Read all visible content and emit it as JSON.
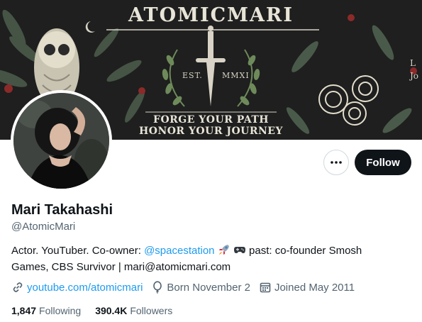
{
  "banner": {
    "title": "ATOMICMARI",
    "est": "EST.",
    "year": "MMXI",
    "tagline_1": "FORGE YOUR PATH",
    "tagline_2": "HONOR YOUR JOURNEY",
    "edge_text_1": "L",
    "edge_text_2": "Jo"
  },
  "actions": {
    "more_icon": "more-horizontal-icon",
    "follow_label": "Follow"
  },
  "profile": {
    "name": "Mari Takahashi",
    "handle": "@AtomicMari",
    "bio_part_1": "Actor. YouTuber. Co-owner: ",
    "bio_mention": "@spacestation",
    "bio_part_2": " past: co-founder Smosh",
    "bio_line_2": "Games, CBS Survivor | mari@atomicmari.com"
  },
  "meta": {
    "website": "youtube.com/atomicmari",
    "birthday": "Born November 2",
    "joined": "Joined May 2011"
  },
  "stats": {
    "following_count": "1,847",
    "following_label": "Following",
    "followers_count": "390.4K",
    "followers_label": "Followers"
  },
  "colors": {
    "accent": "#1d9bf0",
    "text_primary": "#0f1419",
    "text_secondary": "#536471",
    "follow_button_bg": "#0f1419",
    "banner_bg": "#1e1f1e"
  }
}
